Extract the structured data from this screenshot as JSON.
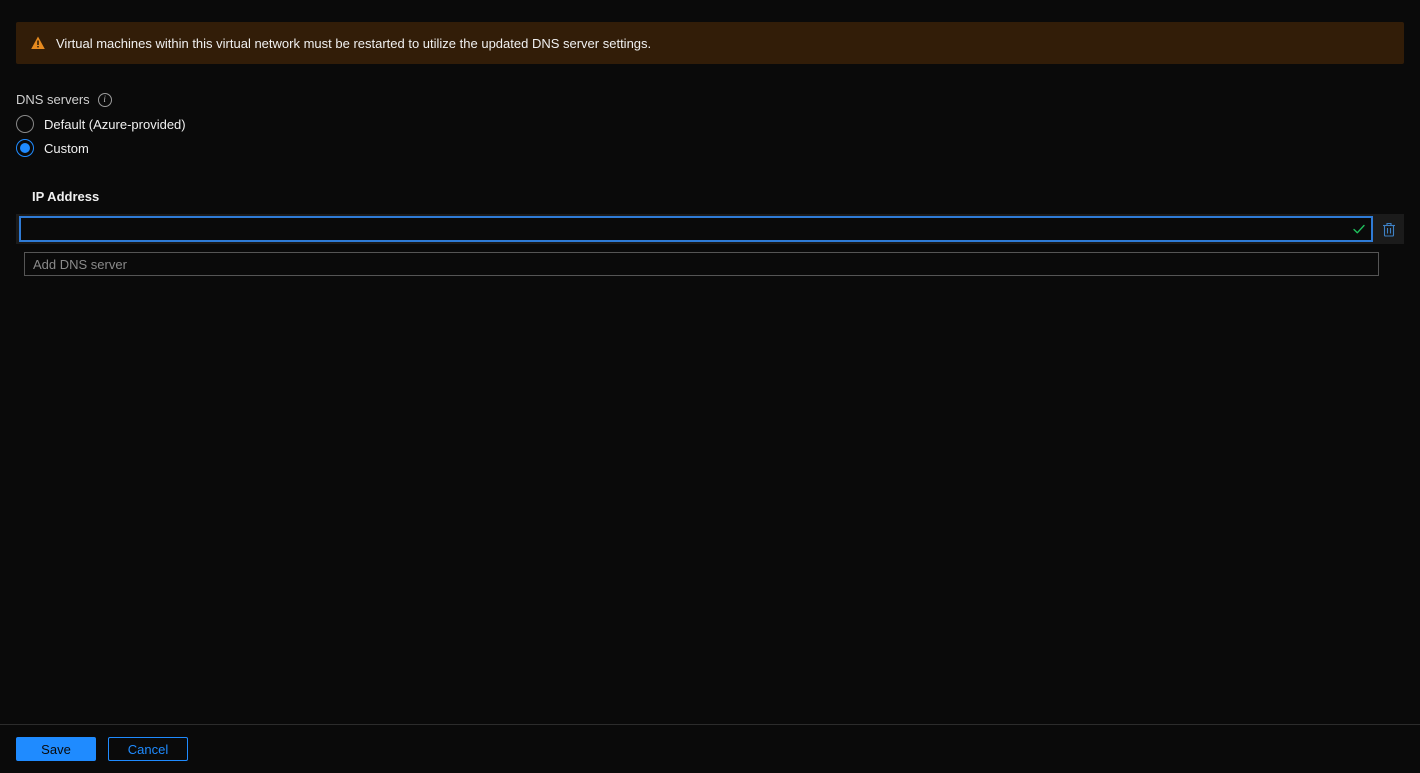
{
  "warning": {
    "message": "Virtual machines within this virtual network must be restarted to utilize the updated DNS server settings."
  },
  "dns": {
    "section_label": "DNS servers",
    "options": {
      "default_label": "Default (Azure-provided)",
      "custom_label": "Custom"
    },
    "selected": "custom",
    "ip_header": "IP Address",
    "entries": [
      {
        "value": ""
      }
    ],
    "add_placeholder": "Add DNS server"
  },
  "footer": {
    "save_label": "Save",
    "cancel_label": "Cancel"
  },
  "icons": {
    "warning": "warning-triangle-icon",
    "info": "info-icon",
    "checkmark": "checkmark-icon",
    "delete": "trash-icon"
  },
  "colors": {
    "accent": "#1f8bff",
    "warn_orange": "#e67e22",
    "check_green": "#1fbf5c",
    "delete_blue": "#4aa3ff"
  }
}
